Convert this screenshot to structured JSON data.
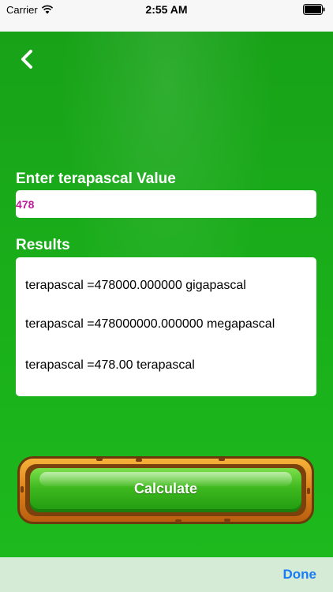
{
  "status_bar": {
    "carrier": "Carrier",
    "time": "2:55 AM"
  },
  "header": {
    "back_icon": "chevron-left-icon"
  },
  "input": {
    "label": "Enter terapascal Value",
    "value": "478"
  },
  "results": {
    "label": "Results",
    "lines": [
      "terapascal =478000.000000 gigapascal",
      "terapascal =478000000.000000 megapascal",
      "terapascal =478.00 terapascal"
    ]
  },
  "calculate_button": {
    "label": "Calculate"
  },
  "accessory_bar": {
    "done_label": "Done"
  },
  "colors": {
    "background": "#1da81d",
    "input_text": "#c01a9a",
    "done_link": "#1a7cf5",
    "button_frame": "#d97c18",
    "button_face": "#3fb81f"
  }
}
